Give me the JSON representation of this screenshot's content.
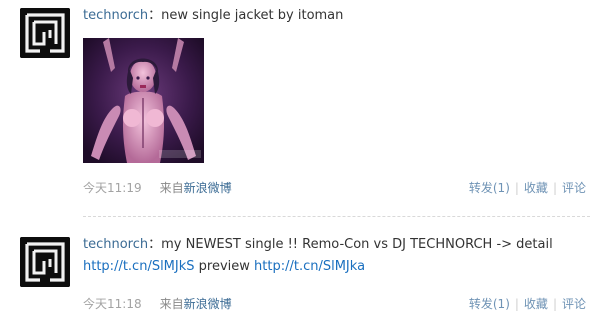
{
  "posts": [
    {
      "username": "technorch",
      "colon": "：",
      "text": "new single jacket by itoman",
      "time": "今天11:19",
      "from_label": "来自",
      "source": "新浪微博",
      "repost": "转发(1)",
      "favorite": "收藏",
      "comment": "评论",
      "separator": "|"
    },
    {
      "username": "technorch",
      "colon": "：",
      "text": "my NEWEST single !! Remo-Con vs DJ TECHNORCH -> detail",
      "link1": "http://t.cn/SlMJkS",
      "mid_text": " preview ",
      "link2": "http://t.cn/SlMJka",
      "time": "今天11:18",
      "from_label": "来自",
      "source": "新浪微博",
      "repost": "转发(1)",
      "favorite": "收藏",
      "comment": "评论",
      "separator": "|"
    }
  ],
  "icons": {
    "avatar": "technorch-logo-icon",
    "thumbnail": "album-jacket-image"
  },
  "colors": {
    "username": "#3b6b94",
    "link": "#1a6fbf",
    "meta": "#a3a3a3",
    "actions": "#6f93b5"
  }
}
